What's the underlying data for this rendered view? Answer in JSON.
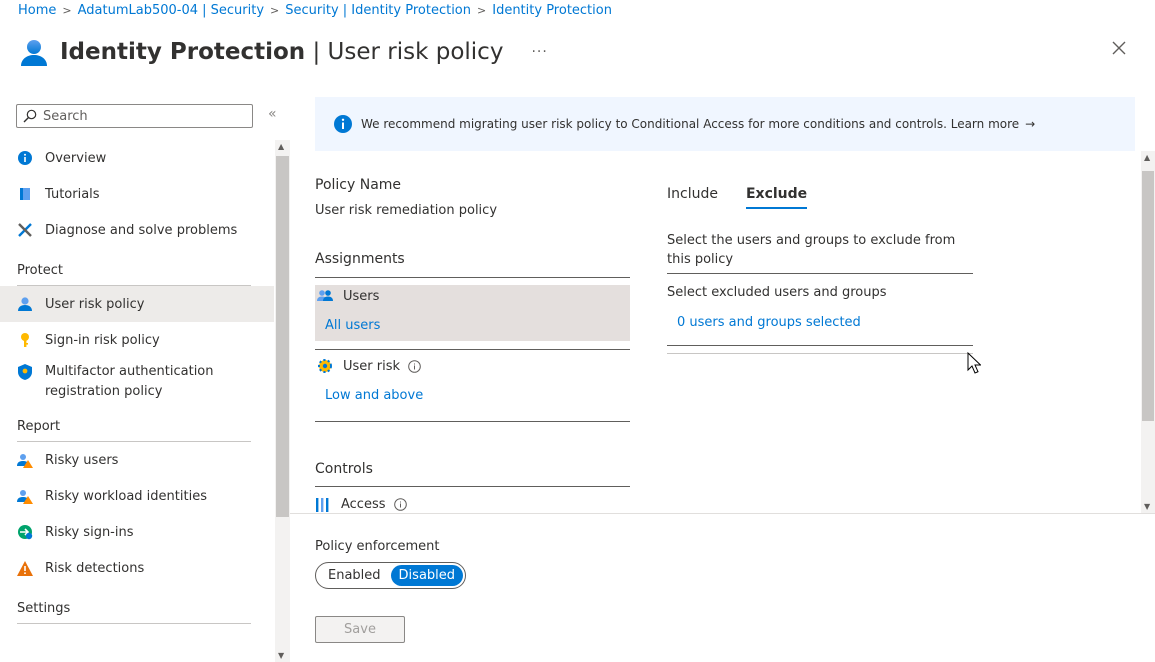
{
  "breadcrumb": [
    "Home",
    "AdatumLab500-04 | Security",
    "Security | Identity Protection",
    "Identity Protection"
  ],
  "page": {
    "title_bold": "Identity Protection",
    "title_rest": " | User risk policy",
    "more": "···",
    "close_icon": "close-icon"
  },
  "sidebar": {
    "search_placeholder": "Search",
    "collapse": "«",
    "items_top": [
      {
        "label": "Overview",
        "icon": "info-icon"
      },
      {
        "label": "Tutorials",
        "icon": "book-icon"
      },
      {
        "label": "Diagnose and solve problems",
        "icon": "wrench-icon"
      }
    ],
    "protect_head": "Protect",
    "protect": [
      {
        "label": "User risk policy",
        "icon": "user-icon",
        "active": true
      },
      {
        "label": "Sign-in risk policy",
        "icon": "key-icon"
      },
      {
        "label": "Multifactor authentication registration policy",
        "icon": "shield-icon"
      }
    ],
    "report_head": "Report",
    "report": [
      {
        "label": "Risky users",
        "icon": "users-warning-icon"
      },
      {
        "label": "Risky workload identities",
        "icon": "users-warning-icon"
      },
      {
        "label": "Risky sign-ins",
        "icon": "signin-icon"
      },
      {
        "label": "Risk detections",
        "icon": "warning-icon"
      }
    ],
    "settings_head": "Settings"
  },
  "banner": {
    "text": "We recommend migrating user risk policy to Conditional Access for more conditions and controls. Learn more",
    "arrow": "→"
  },
  "policy": {
    "name_label": "Policy Name",
    "name_value": "User risk remediation policy",
    "assignments_label": "Assignments",
    "users_title": "Users",
    "users_value": "All users",
    "user_risk_title": "User risk",
    "user_risk_value": "Low and above",
    "controls_label": "Controls",
    "access_title": "Access"
  },
  "exclude_panel": {
    "tabs": [
      "Include",
      "Exclude"
    ],
    "selected_tab": "Exclude",
    "description": "Select the users and groups to exclude from this policy",
    "select_label": "Select excluded users and groups",
    "selected_link": "0 users and groups selected"
  },
  "enforcement": {
    "label": "Policy enforcement",
    "enabled": "Enabled",
    "disabled": "Disabled",
    "value": "Disabled"
  },
  "save_label": "Save",
  "colors": {
    "accent": "#0078d4",
    "selected_block": "#e4dfdd",
    "banner_bg": "#f0f6ff"
  }
}
